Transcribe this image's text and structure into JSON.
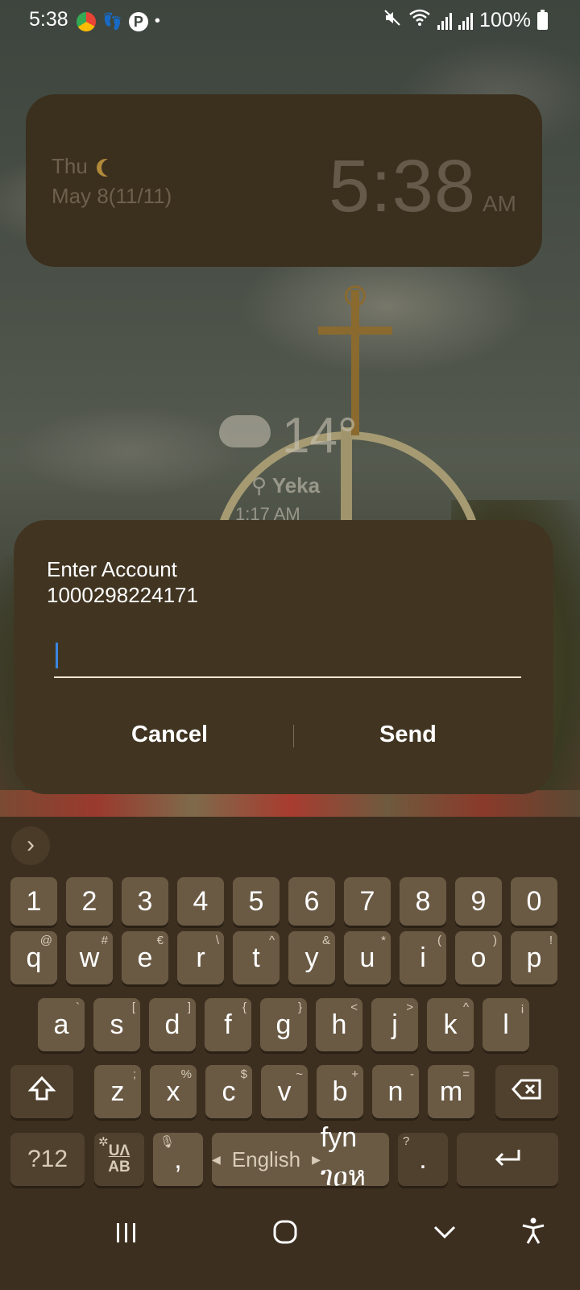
{
  "status_bar": {
    "time": "5:38",
    "battery": "100%",
    "app_icons": [
      "chrome-icon",
      "feet-icon",
      "pinterest-icon",
      "dot-icon"
    ],
    "system_icons": [
      "mute-icon",
      "wifi-icon",
      "signal-icon",
      "signal-icon",
      "battery-icon"
    ]
  },
  "clock_widget": {
    "day": "Thu",
    "date": "May 8(11/11)",
    "time": "5:38",
    "ampm": "AM"
  },
  "weather": {
    "temperature": "14°",
    "location": "Yeka",
    "updated": "1:17 AM"
  },
  "dialog": {
    "title": "Enter Account",
    "account": "1000298224171",
    "input_value": "",
    "cancel_label": "Cancel",
    "send_label": "Send"
  },
  "keyboard": {
    "row_numbers": [
      "1",
      "2",
      "3",
      "4",
      "5",
      "6",
      "7",
      "8",
      "9",
      "0"
    ],
    "row_top": [
      {
        "k": "q",
        "s": "@"
      },
      {
        "k": "w",
        "s": "#"
      },
      {
        "k": "e",
        "s": "€"
      },
      {
        "k": "r",
        "s": "\\"
      },
      {
        "k": "t",
        "s": "^"
      },
      {
        "k": "y",
        "s": "&"
      },
      {
        "k": "u",
        "s": "*"
      },
      {
        "k": "i",
        "s": "("
      },
      {
        "k": "o",
        "s": ")"
      },
      {
        "k": "p",
        "s": "!"
      }
    ],
    "row_mid": [
      {
        "k": "a",
        "s": "`"
      },
      {
        "k": "s",
        "s": "["
      },
      {
        "k": "d",
        "s": "]"
      },
      {
        "k": "f",
        "s": "{"
      },
      {
        "k": "g",
        "s": "}"
      },
      {
        "k": "h",
        "s": "<"
      },
      {
        "k": "j",
        "s": ">"
      },
      {
        "k": "k",
        "s": "^"
      },
      {
        "k": "l",
        "s": "¡"
      }
    ],
    "row_bottom": [
      {
        "k": "z",
        "s": ";"
      },
      {
        "k": "x",
        "s": "%"
      },
      {
        "k": "c",
        "s": "$"
      },
      {
        "k": "v",
        "s": "~"
      },
      {
        "k": "b",
        "s": "+"
      },
      {
        "k": "n",
        "s": "-"
      },
      {
        "k": "m",
        "s": "="
      }
    ],
    "symbols_label": "?12",
    "lang_switch_top": "UΛ",
    "lang_switch_bottom": "AB",
    "comma": ",",
    "space_label": "English",
    "space_langs": "fyn ገዐห",
    "period": ".",
    "period_sub": "?"
  }
}
